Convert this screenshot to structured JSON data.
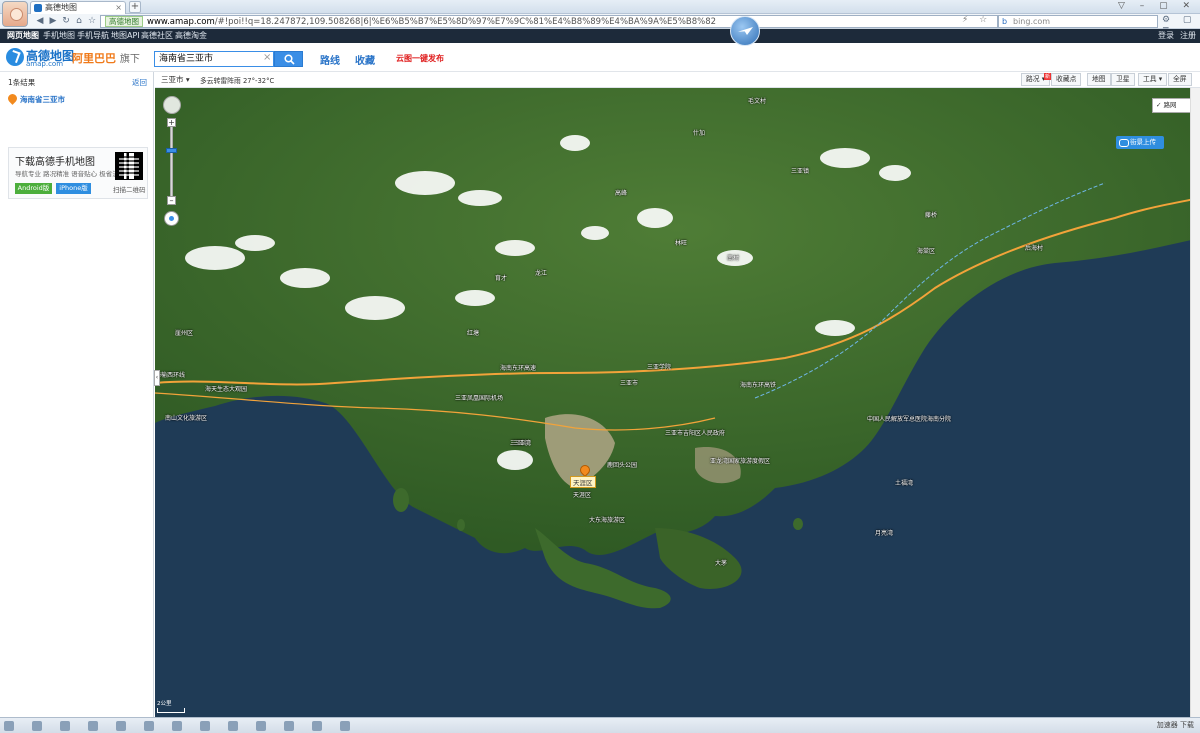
{
  "browser": {
    "tab_title": "高德地图",
    "url_site": "高德地图",
    "url_domain": "www.amap.com",
    "url_rest": "/#!poi!!q=18.247872,109.508268|6|%E6%B5%B7%E5%8D%97%E7%9C%81%E4%B8%89%E4%BA%9A%E5%B8%82",
    "search_placeholder": "bing.com"
  },
  "site_nav": {
    "items": [
      "网页地图",
      "手机地图",
      "手机导航",
      "地图API",
      "高德社区",
      "高德淘金"
    ],
    "right": [
      "登录",
      "注册"
    ]
  },
  "header": {
    "logo_cn": "高德地图",
    "logo_en": "amap.com",
    "alibaba": "阿里巴巴",
    "alibaba_suffix": "旗下",
    "search_value": "海南省三亚市",
    "route": "路线",
    "favorites": "收藏",
    "cloud_publish": "云图一键发布"
  },
  "left_panel": {
    "result_count": "1条结果",
    "back": "返回",
    "result_name": "海南省三亚市",
    "download": {
      "title": "下载高德手机地图",
      "subtitle": "导航专业 路况精准 语音贴心 极省流量",
      "android": "Android版",
      "iphone": "iPhone版",
      "qr_caption": "扫描二维码"
    }
  },
  "map_toolbar": {
    "city": "三亚市",
    "weather": "多云转雷阵雨 27°-32°C",
    "buttons": [
      "路况",
      "收藏点",
      "地图",
      "卫星",
      "工具",
      "全屏"
    ],
    "badge": "新"
  },
  "map": {
    "road_net": "路网",
    "panorama": "街景上传",
    "pin_label": "天涯区",
    "labels": [
      "毛文村",
      "什加",
      "三亚镇",
      "海棠区",
      "天涯区",
      "崖州区",
      "三亚市",
      "大东海旅游区",
      "南山文化旅游区",
      "三亚河",
      "亚龙湾国家旅游度假区",
      "中国人民解放军总医院海南分院",
      "海天生态大观园",
      "三亚凤凰国际机场",
      "三亚学院",
      "林旺",
      "后海村",
      "龙江",
      "藤桥",
      "海榆西环线",
      "海南东环高铁",
      "海南东环高速",
      "三亚湾",
      "鹿回头公园",
      "红塘",
      "育才",
      "南村",
      "三亚市吉阳区人民政府",
      "月亮湾",
      "大茅",
      "土福湾",
      "高峰"
    ],
    "scale": "2公里",
    "colors": {
      "sea": "#1f3b56",
      "land": "#3d6a2c",
      "road": "#f2a33a",
      "rail": "#6fb6e6",
      "city": "#b8aa8c"
    }
  },
  "status_bar": {
    "right": "加速器  下载"
  }
}
